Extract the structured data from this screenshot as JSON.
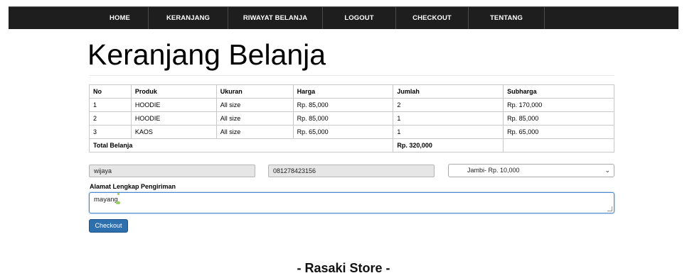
{
  "nav": {
    "items": [
      "HOME",
      "KERANJANG",
      "RIWAYAT BELANJA",
      "LOGOUT",
      "CHECKOUT",
      "TENTANG"
    ]
  },
  "page": {
    "title": "Keranjang Belanja"
  },
  "cart": {
    "headers": [
      "No",
      "Produk",
      "Ukuran",
      "Harga",
      "Jumlah",
      "Subharga"
    ],
    "rows": [
      [
        "1",
        "HOODIE",
        "All size",
        "Rp. 85,000",
        "2",
        "Rp. 170,000"
      ],
      [
        "2",
        "HOODIE",
        "All size",
        "Rp. 85,000",
        "1",
        "Rp. 85,000"
      ],
      [
        "3",
        "KAOS",
        "All size",
        "Rp. 65,000",
        "1",
        "Rp. 65,000"
      ]
    ],
    "total_label": "Total Belanja",
    "total_value": "Rp. 320,000"
  },
  "form": {
    "name_value": "wijaya",
    "phone_value": "081278423156",
    "shipping_selected": "Jambi- Rp. 10,000",
    "address_label": "Alamat Lengkap Pengiriman",
    "address_value": "mayang",
    "checkout_label": "Checkout"
  },
  "footer": {
    "text": "- Rasaki Store -"
  }
}
